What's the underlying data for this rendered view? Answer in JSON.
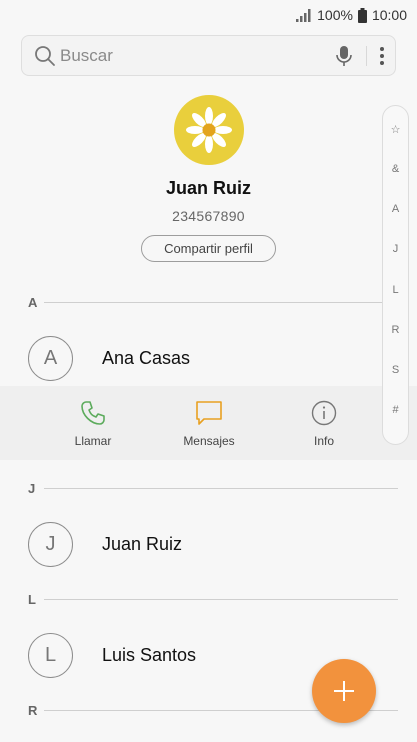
{
  "status_bar": {
    "battery": "100%",
    "time": "10:00"
  },
  "search": {
    "placeholder": "Buscar"
  },
  "profile": {
    "name": "Juan Ruiz",
    "number": "234567890",
    "share_label": "Compartir perfil"
  },
  "sections": [
    {
      "letter": "A"
    },
    {
      "letter": "J"
    },
    {
      "letter": "L"
    },
    {
      "letter": "R"
    }
  ],
  "contacts": [
    {
      "initial": "A",
      "name": "Ana Casas"
    },
    {
      "initial": "J",
      "name": "Juan Ruiz"
    },
    {
      "initial": "L",
      "name": "Luis Santos"
    }
  ],
  "actions": {
    "call_label": "Llamar",
    "message_label": "Mensajes",
    "info_label": "Info"
  },
  "index": [
    "☆",
    "&",
    "A",
    "J",
    "L",
    "R",
    "S",
    "#"
  ],
  "colors": {
    "accent": "#f2923d",
    "call_icon": "#5cab5c",
    "message_icon": "#e8a020",
    "avatar_bg": "#e9cf3c"
  }
}
